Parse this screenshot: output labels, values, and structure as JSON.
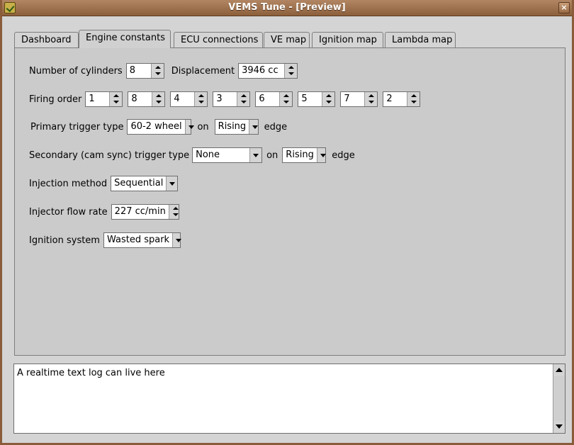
{
  "window": {
    "title": "VEMS Tune - [Preview]",
    "close_glyph": "×"
  },
  "tabs": [
    {
      "label": "Dashboard"
    },
    {
      "label": "Engine constants"
    },
    {
      "label": "ECU connections"
    },
    {
      "label": "VE map"
    },
    {
      "label": "Ignition map"
    },
    {
      "label": "Lambda map"
    }
  ],
  "active_tab": "Engine constants",
  "form": {
    "cylinders": {
      "label": "Number of cylinders",
      "value": "8"
    },
    "displacement": {
      "label": "Displacement",
      "value": "3946 cc"
    },
    "firing_order": {
      "label": "Firing order",
      "values": [
        "1",
        "8",
        "4",
        "3",
        "6",
        "5",
        "7",
        "2"
      ]
    },
    "primary_trigger": {
      "label": "Primary trigger type",
      "value": "60-2 wheel",
      "on": "on",
      "edge_value": "Rising",
      "edge": "edge"
    },
    "secondary_trigger": {
      "label": "Secondary (cam sync) trigger type",
      "value": "None",
      "on": "on",
      "edge_value": "Rising",
      "edge": "edge"
    },
    "injection_method": {
      "label": "Injection method",
      "value": "Sequential"
    },
    "injector_flow": {
      "label": "Injector flow rate",
      "value": "227 cc/min"
    },
    "ignition_system": {
      "label": "Ignition system",
      "value": "Wasted spark"
    }
  },
  "log": {
    "text": "A realtime text log can live here"
  }
}
